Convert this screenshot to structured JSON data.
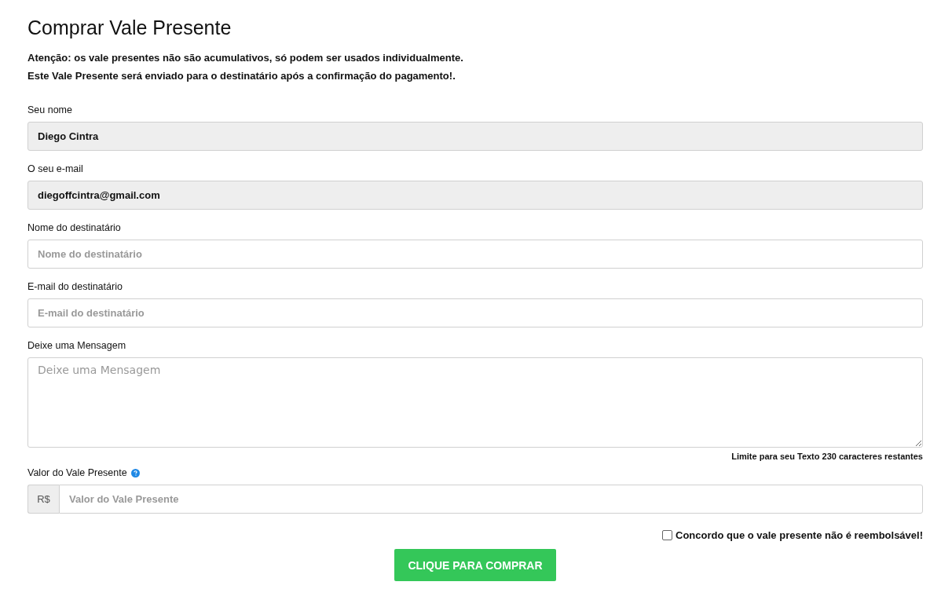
{
  "title": "Comprar Vale Presente",
  "notices": [
    "Atenção: os vale presentes não são acumulativos, só podem ser usados individualmente.",
    "Este Vale Presente será enviado para o destinatário após a confirmação do pagamento!."
  ],
  "fields": [
    {
      "kind": "text",
      "label": "Seu nome",
      "value": "Diego Cintra",
      "disabled": true
    },
    {
      "kind": "text",
      "label": "O seu e-mail",
      "value": "diegoffcintra@gmail.com",
      "disabled": true
    },
    {
      "kind": "text",
      "label": "Nome do destinatário",
      "placeholder": "Nome do destinatário",
      "disabled": false
    },
    {
      "kind": "text",
      "label": "E-mail do destinatário",
      "placeholder": "E-mail do destinatário",
      "disabled": false
    },
    {
      "kind": "textarea",
      "label": "Deixe uma Mensagem",
      "placeholder": "Deixe uma Mensagem",
      "counter": "Limite para seu Texto 230 caracteres restantes",
      "disabled": false
    },
    {
      "kind": "currency",
      "label": "Valor do Vale Presente",
      "help": true,
      "prefix": "R$",
      "placeholder": "Valor do Vale Presente",
      "disabled": false
    }
  ],
  "agree": {
    "label": "Concordo que o vale presente não é reembolsável!",
    "checked": false
  },
  "submit": "CLIQUE PARA COMPRAR"
}
